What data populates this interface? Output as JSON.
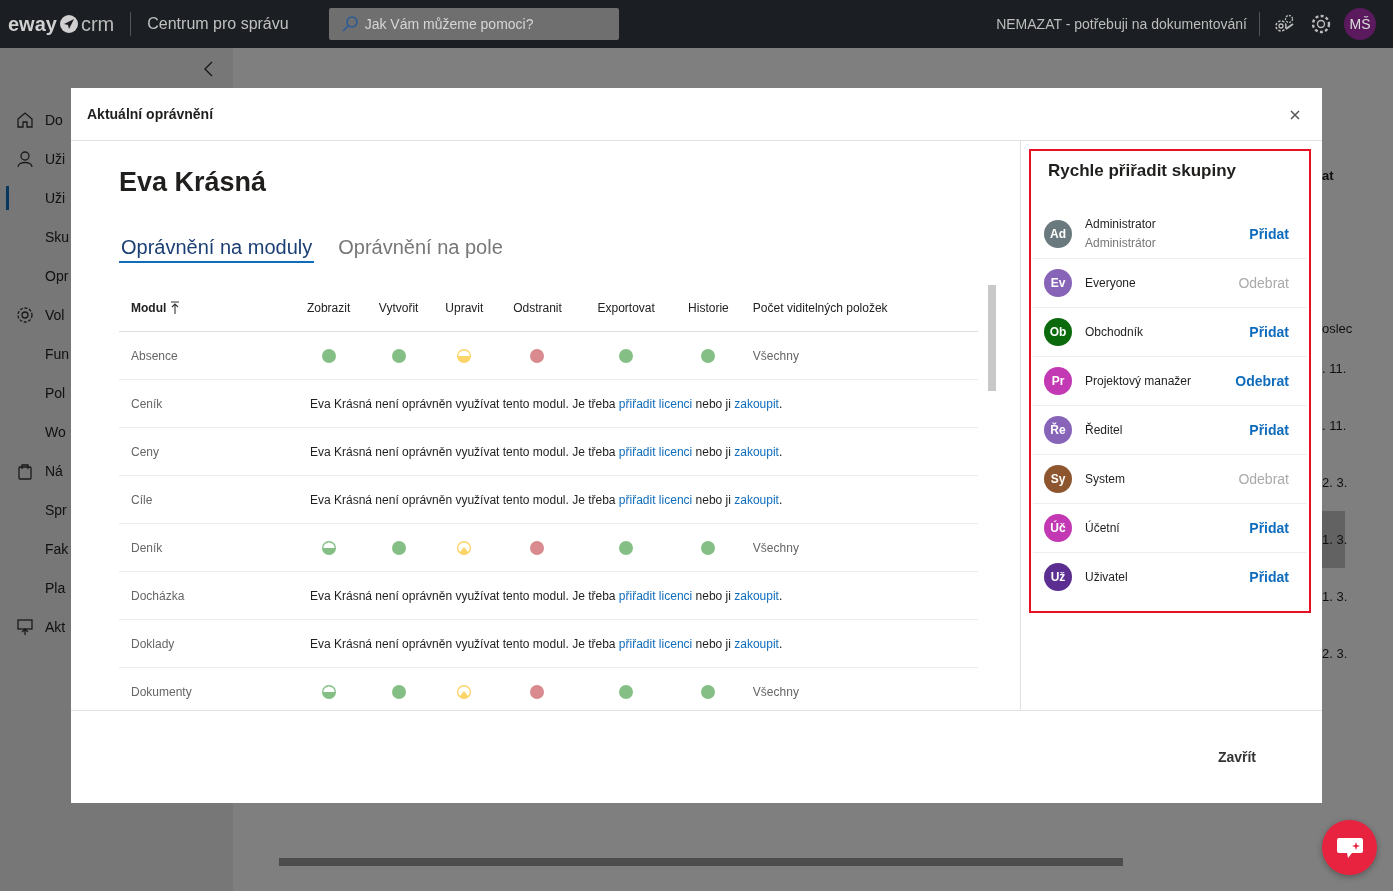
{
  "topbar": {
    "logo_left": "eway",
    "logo_right": "crm",
    "section": "Centrum pro správu",
    "search": {
      "placeholder": "Jak Vám můžeme pomoci?"
    },
    "environment": "NEMAZAT - potřebuji na dokumentování",
    "avatar": "MŠ"
  },
  "sidebar": {
    "items": [
      {
        "label": "Do",
        "kind": "section",
        "selected": false
      },
      {
        "label": "Uži",
        "kind": "section",
        "selected": false
      },
      {
        "label": "Uži",
        "kind": "item",
        "selected": true
      },
      {
        "label": "Sku",
        "kind": "item",
        "selected": false
      },
      {
        "label": "Opr",
        "kind": "item",
        "selected": false
      },
      {
        "label": "Vol",
        "kind": "section",
        "selected": false
      },
      {
        "label": "Fun",
        "kind": "item",
        "selected": false
      },
      {
        "label": "Pol",
        "kind": "item",
        "selected": false
      },
      {
        "label": "Wo",
        "kind": "item",
        "selected": false
      },
      {
        "label": "Ná",
        "kind": "section",
        "selected": false
      },
      {
        "label": "Spr",
        "kind": "item",
        "selected": false
      },
      {
        "label": "Fak",
        "kind": "item",
        "selected": false
      },
      {
        "label": "Pla",
        "kind": "item",
        "selected": false
      },
      {
        "label": "Akt",
        "kind": "section",
        "selected": false
      }
    ]
  },
  "page": {
    "column_header": "at",
    "column_header_2": "oslec",
    "cells": [
      {
        "text": ". 11.",
        "selected": false
      },
      {
        "text": ". 11.",
        "selected": false
      },
      {
        "text": "2. 3.",
        "selected": false
      },
      {
        "text": "1. 3.",
        "selected": true
      },
      {
        "text": "1. 3.",
        "selected": false
      },
      {
        "text": "2. 3.",
        "selected": false
      }
    ]
  },
  "dialog": {
    "title": "Aktuální oprávnění",
    "user": "Eva Krásná",
    "tabs": [
      {
        "label": "Oprávnění na moduly",
        "selected": true
      },
      {
        "label": "Oprávnění na pole",
        "selected": false
      }
    ],
    "table": {
      "columns": [
        "Modul",
        "Zobrazit",
        "Vytvořit",
        "Upravit",
        "Odstranit",
        "Exportovat",
        "Historie",
        "Počet viditelných položek"
      ],
      "rows": [
        {
          "module": "Absence",
          "permissions": [
            {
              "kind": "full"
            },
            {
              "kind": "full"
            },
            {
              "kind": "half-yellow"
            },
            {
              "kind": "denied"
            },
            {
              "kind": "full"
            },
            {
              "kind": "full"
            }
          ],
          "visible": "Všechny"
        },
        {
          "module": "Ceník",
          "notice": {
            "before": "Eva Krásná není oprávněn využívat tento modul. Je třeba ",
            "link": "přiřadit licenci",
            "middle": " nebo ji ",
            "link_2": "zakoupit",
            "after": "."
          }
        },
        {
          "module": "Ceny",
          "notice": {
            "before": "Eva Krásná není oprávněn využívat tento modul. Je třeba ",
            "link": "přiřadit licenci",
            "middle": " nebo ji ",
            "link_2": "zakoupit",
            "after": "."
          }
        },
        {
          "module": "Cíle",
          "notice": {
            "before": "Eva Krásná není oprávněn využívat tento modul. Je třeba ",
            "link": "přiřadit licenci",
            "middle": " nebo ji ",
            "link_2": "zakoupit",
            "after": "."
          }
        },
        {
          "module": "Deník",
          "permissions": [
            {
              "kind": "half-green"
            },
            {
              "kind": "full"
            },
            {
              "kind": "peak-yellow"
            },
            {
              "kind": "denied"
            },
            {
              "kind": "full"
            },
            {
              "kind": "full"
            }
          ],
          "visible": "Všechny"
        },
        {
          "module": "Docházka",
          "notice": {
            "before": "Eva Krásná není oprávněn využívat tento modul. Je třeba ",
            "link": "přiřadit licenci",
            "middle": " nebo ji ",
            "link_2": "zakoupit",
            "after": "."
          }
        },
        {
          "module": "Doklady",
          "notice": {
            "before": "Eva Krásná není oprávněn využívat tento modul. Je třeba ",
            "link": "přiřadit licenci",
            "middle": " nebo ji ",
            "link_2": "zakoupit",
            "after": "."
          }
        },
        {
          "module": "Dokumenty",
          "permissions": [
            {
              "kind": "half-green"
            },
            {
              "kind": "full"
            },
            {
              "kind": "peak-yellow"
            },
            {
              "kind": "denied"
            },
            {
              "kind": "full"
            },
            {
              "kind": "full"
            }
          ],
          "visible": "Všechny"
        }
      ]
    },
    "groups": {
      "title": "Rychle přiřadit skupiny",
      "items": [
        {
          "initials": "Ad",
          "color": "#69797e",
          "name": "Administrator",
          "subtitle": "Administrátor",
          "action": "Přidat",
          "disabled": false
        },
        {
          "initials": "Ev",
          "color": "#8764b8",
          "name": "Everyone",
          "action": "Odebrat",
          "disabled": true
        },
        {
          "initials": "Ob",
          "color": "#0b6a0b",
          "name": "Obchodník",
          "action": "Přidat",
          "disabled": false
        },
        {
          "initials": "Pr",
          "color": "#c239b3",
          "name": "Projektový manažer",
          "action": "Odebrat",
          "disabled": false
        },
        {
          "initials": "Ře",
          "color": "#8764b8",
          "name": "Ředitel",
          "action": "Přidat",
          "disabled": false
        },
        {
          "initials": "Sy",
          "color": "#8e562e",
          "name": "System",
          "action": "Odebrat",
          "disabled": true
        },
        {
          "initials": "Úč",
          "color": "#c239b3",
          "name": "Účetní",
          "action": "Přidat",
          "disabled": false
        },
        {
          "initials": "Už",
          "color": "#5c2e91",
          "name": "Uživatel",
          "action": "Přidat",
          "disabled": false
        }
      ]
    },
    "close_button": "Zavřít"
  }
}
